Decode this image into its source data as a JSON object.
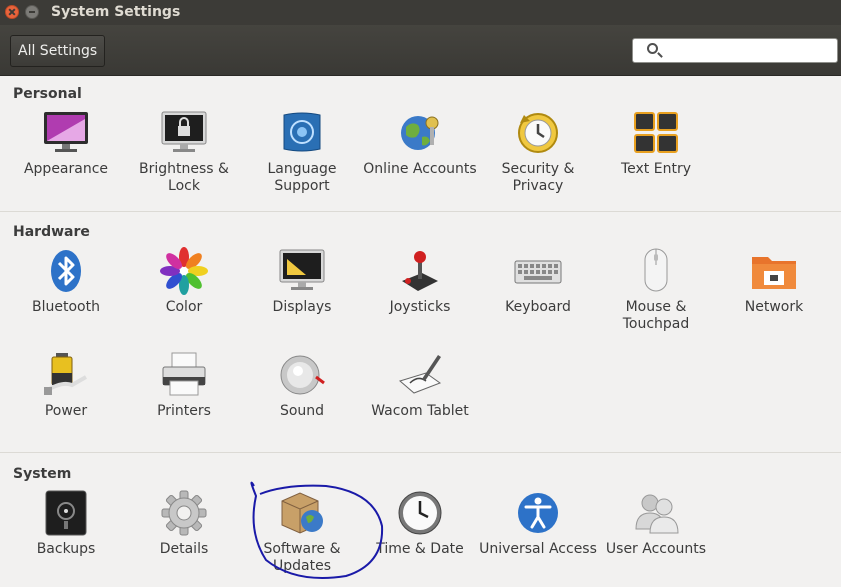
{
  "window": {
    "title": "System Settings"
  },
  "toolbar": {
    "all_settings_label": "All Settings",
    "search_placeholder": ""
  },
  "sections": {
    "personal": {
      "title": "Personal",
      "items": [
        {
          "label": "Appearance",
          "icon": "appearance-icon"
        },
        {
          "label": "Brightness & Lock",
          "icon": "brightness-lock-icon"
        },
        {
          "label": "Language Support",
          "icon": "language-support-icon"
        },
        {
          "label": "Online Accounts",
          "icon": "online-accounts-icon"
        },
        {
          "label": "Security & Privacy",
          "icon": "security-privacy-icon"
        },
        {
          "label": "Text Entry",
          "icon": "text-entry-icon"
        }
      ]
    },
    "hardware": {
      "title": "Hardware",
      "items": [
        {
          "label": "Bluetooth",
          "icon": "bluetooth-icon"
        },
        {
          "label": "Color",
          "icon": "color-icon"
        },
        {
          "label": "Displays",
          "icon": "displays-icon"
        },
        {
          "label": "Joysticks",
          "icon": "joystick-icon"
        },
        {
          "label": "Keyboard",
          "icon": "keyboard-icon"
        },
        {
          "label": "Mouse & Touchpad",
          "icon": "mouse-icon"
        },
        {
          "label": "Network",
          "icon": "network-icon"
        },
        {
          "label": "Power",
          "icon": "power-icon"
        },
        {
          "label": "Printers",
          "icon": "printer-icon"
        },
        {
          "label": "Sound",
          "icon": "sound-icon"
        },
        {
          "label": "Wacom Tablet",
          "icon": "wacom-tablet-icon"
        }
      ]
    },
    "system": {
      "title": "System",
      "items": [
        {
          "label": "Backups",
          "icon": "backups-icon"
        },
        {
          "label": "Details",
          "icon": "gear-icon"
        },
        {
          "label": "Software & Updates",
          "icon": "software-updates-icon"
        },
        {
          "label": "Time & Date",
          "icon": "clock-icon"
        },
        {
          "label": "Universal Access",
          "icon": "universal-access-icon"
        },
        {
          "label": "User Accounts",
          "icon": "user-accounts-icon"
        }
      ]
    }
  },
  "annotation": {
    "icon": "hand-drawn-circle-annotation",
    "color": "#1a1aa8"
  },
  "colors": {
    "titlebar": "#3c3b37",
    "close_button": "#e8643c",
    "background": "#f2f1f0"
  }
}
